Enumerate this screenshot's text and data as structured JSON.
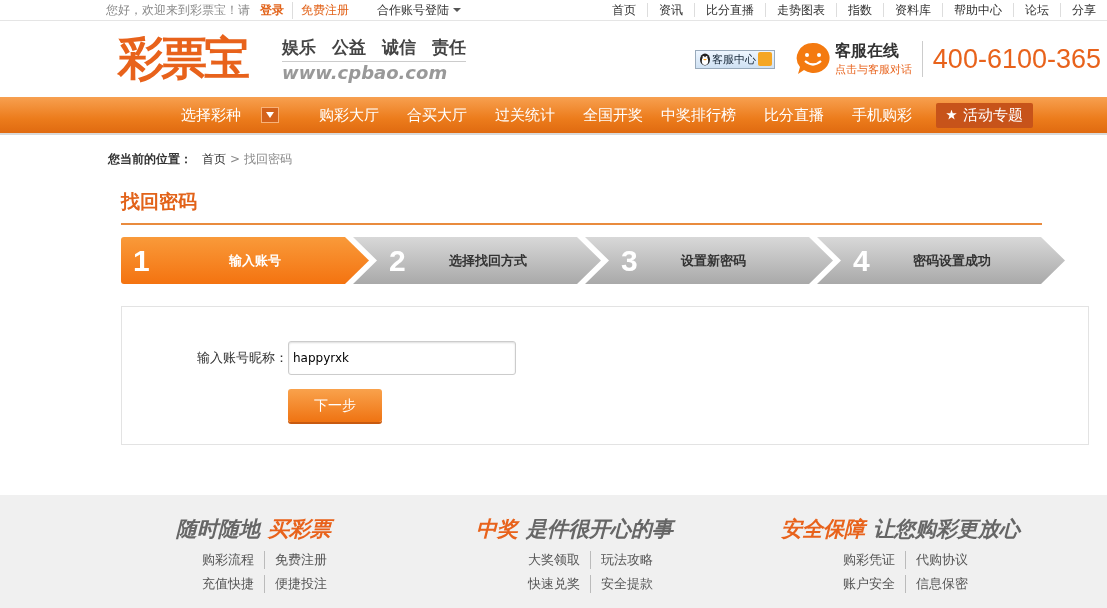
{
  "top_bar": {
    "greeting": "您好，欢迎来到彩票宝！请",
    "login": "登录",
    "register": "免费注册",
    "partner_login": "合作账号登陆",
    "links": [
      "首页",
      "资讯",
      "比分直播",
      "走势图表",
      "指数",
      "资料库",
      "帮助中心",
      "论坛",
      "分享"
    ]
  },
  "header": {
    "logo": "彩票宝",
    "slogans": [
      "娱乐",
      "公益",
      "诚信",
      "责任"
    ],
    "url": "www.cpbao.com",
    "service_badge": "客服中心",
    "online_title": "客服在线",
    "online_sub": "点击与客服对话",
    "phone": "400-6100-365"
  },
  "nav": {
    "select_label": "选择彩种",
    "items": [
      "购彩大厅",
      "合买大厅",
      "过关统计",
      "全国开奖",
      "中奖排行榜",
      "比分直播",
      "手机购彩"
    ],
    "special": "活动专题"
  },
  "breadcrumb": {
    "label": "您当前的位置：",
    "home": "首页",
    "separator": ">",
    "current": "找回密码"
  },
  "page_title": "找回密码",
  "steps": [
    {
      "number": "1",
      "label": "输入账号",
      "selected": true
    },
    {
      "number": "2",
      "label": "选择找回方式",
      "selected": false
    },
    {
      "number": "3",
      "label": "设置新密码",
      "selected": false
    },
    {
      "number": "4",
      "label": "密码设置成功",
      "selected": false
    }
  ],
  "form": {
    "label": "输入账号昵称：",
    "value": "happyrxk",
    "button": "下一步"
  },
  "footer": [
    {
      "slogan": [
        {
          "text": "随时随地",
          "accent": false
        },
        {
          "text": "买彩票",
          "accent": true
        }
      ],
      "links": [
        [
          "购彩流程",
          "免费注册"
        ],
        [
          "充值快捷",
          "便捷投注"
        ]
      ]
    },
    {
      "slogan": [
        {
          "text": "中奖",
          "accent": true
        },
        {
          "text": "是件很开心的事",
          "accent": false
        }
      ],
      "links": [
        [
          "大奖领取",
          "玩法攻略"
        ],
        [
          "快速兑奖",
          "安全提款"
        ]
      ]
    },
    {
      "slogan": [
        {
          "text": "安全保障",
          "accent": true
        },
        {
          "text": "让您购彩更放心",
          "accent": false
        }
      ],
      "links": [
        [
          "购彩凭证",
          "代购协议"
        ],
        [
          "账户安全",
          "信息保密"
        ]
      ]
    }
  ]
}
